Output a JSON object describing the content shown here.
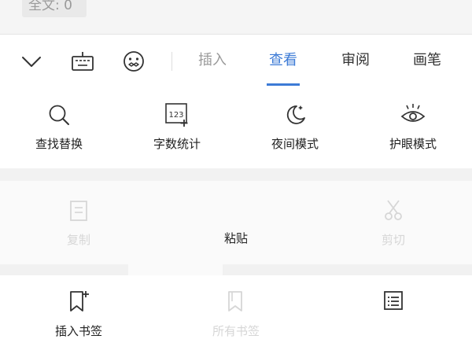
{
  "status": {
    "word_count": "全文: 0"
  },
  "toolbar": {
    "icons": [
      "chevron-down-icon",
      "keyboard-icon",
      "emoji-face-icon"
    ],
    "tabs": [
      {
        "label": "插入",
        "state": "inactive"
      },
      {
        "label": "查看",
        "state": "active"
      },
      {
        "label": "审阅",
        "state": "normal"
      },
      {
        "label": "画笔",
        "state": "normal"
      }
    ],
    "accent_color": "#3d7bd6"
  },
  "tools": [
    {
      "label": "查找替换",
      "icon": "search-icon"
    },
    {
      "label": "字数统计",
      "icon": "word-count-icon"
    },
    {
      "label": "夜间模式",
      "icon": "moon-icon"
    },
    {
      "label": "护眼模式",
      "icon": "eye-icon"
    }
  ],
  "context_menu": {
    "copy": {
      "label": "复制",
      "icon": "copy-icon",
      "enabled": false
    },
    "paste": {
      "label": "粘贴",
      "enabled": true
    },
    "cut": {
      "label": "剪切",
      "icon": "scissors-icon",
      "enabled": false
    },
    "insert_bookmark": {
      "label": "插入书签",
      "icon": "bookmark-add-icon",
      "enabled": true
    },
    "all_bookmarks": {
      "label": "所有书签",
      "icon": "bookmarks-icon",
      "enabled": false
    },
    "list": {
      "icon": "list-icon",
      "enabled": true
    }
  }
}
